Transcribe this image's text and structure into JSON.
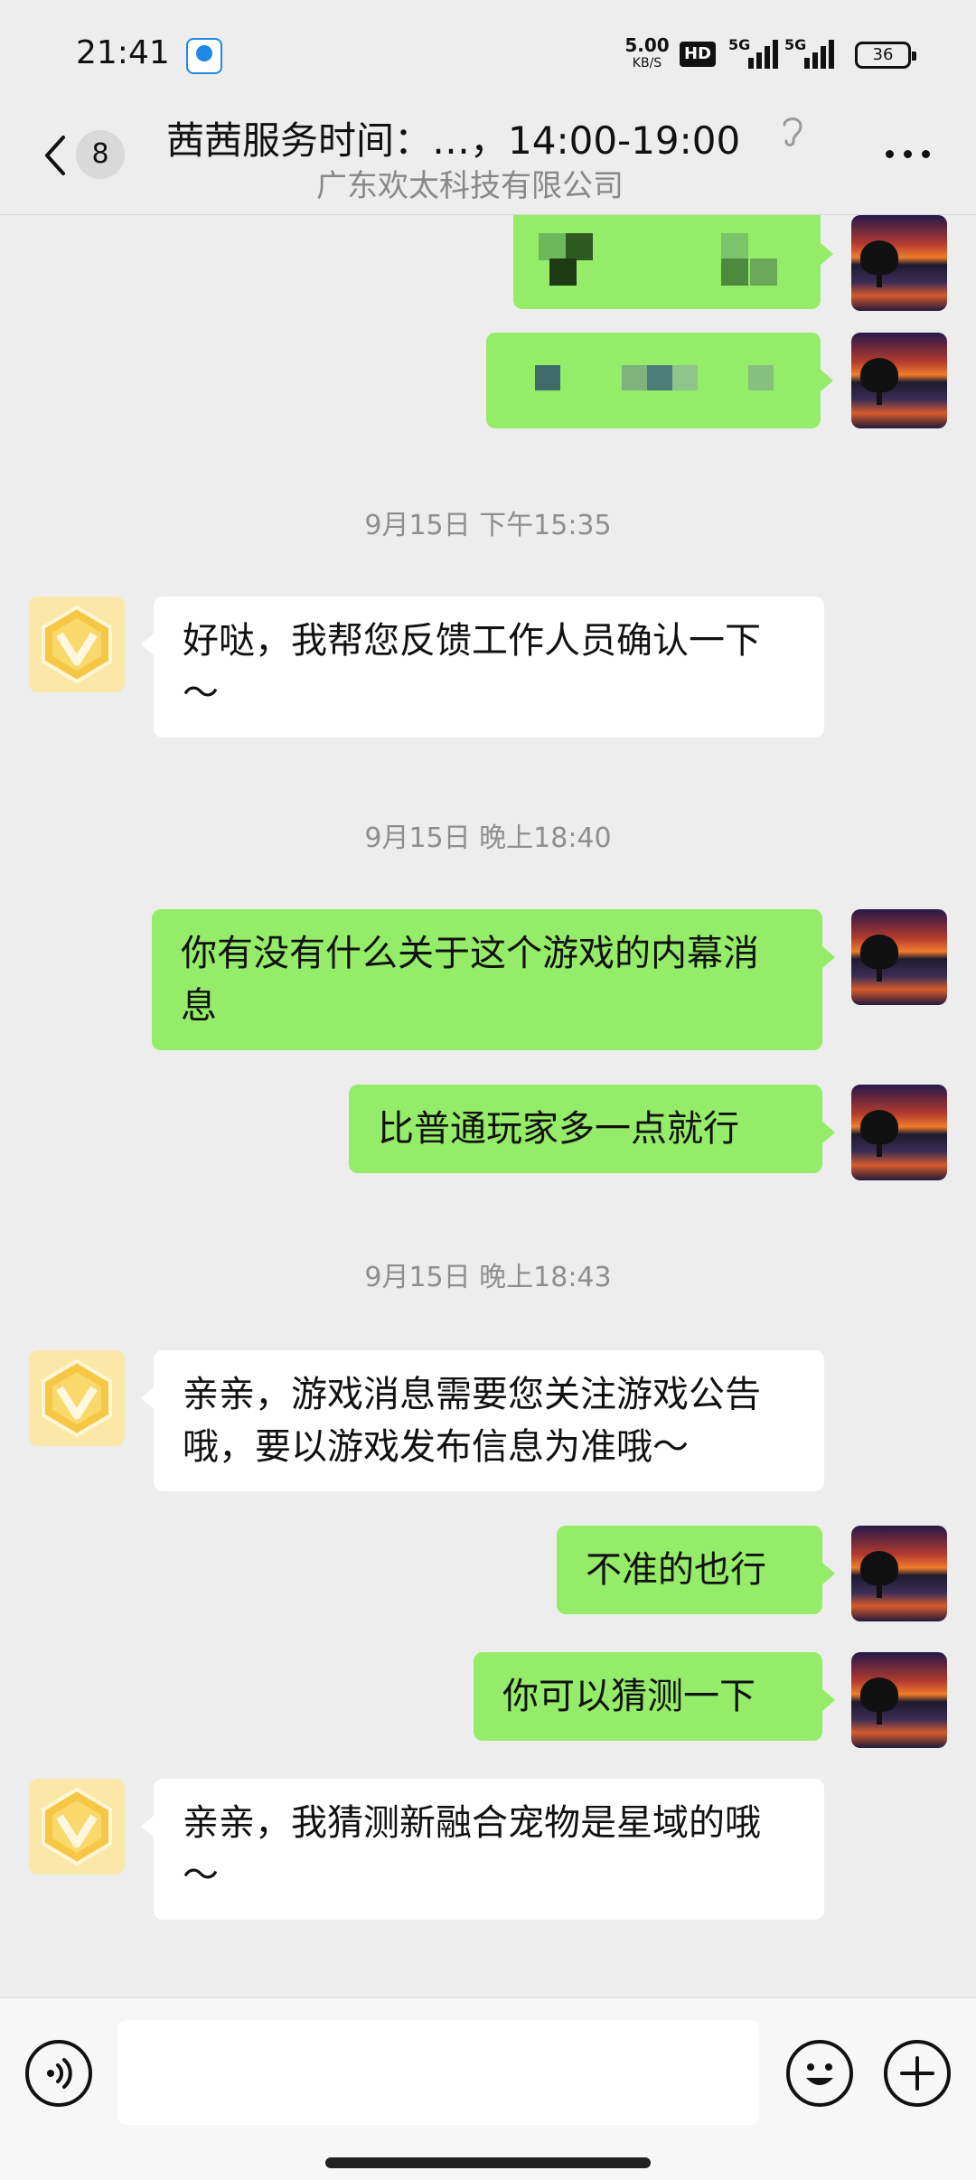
{
  "status_bar": {
    "time": "21:41",
    "net_speed_value": "5.00",
    "net_speed_unit": "KB/S",
    "hd_label": "HD",
    "signal_1_label": "5G",
    "signal_2_label": "5G",
    "battery": "36"
  },
  "header": {
    "unread_count": "8",
    "title": "茜茜服务时间：…，14:00-19:00",
    "subtitle": "广东欢太科技有限公司"
  },
  "messages": [
    {
      "type": "timestamp",
      "text": "9月15日 下午15:35"
    },
    {
      "type": "in",
      "text": "好哒，我帮您反馈工作人员确认一下～"
    },
    {
      "type": "timestamp",
      "text": "9月15日 晚上18:40"
    },
    {
      "type": "out",
      "text": "你有没有什么关于这个游戏的内幕消息"
    },
    {
      "type": "out",
      "text": "比普通玩家多一点就行"
    },
    {
      "type": "timestamp",
      "text": "9月15日 晚上18:43"
    },
    {
      "type": "in",
      "text": "亲亲，游戏消息需要您关注游戏公告哦，要以游戏发布信息为准哦～"
    },
    {
      "type": "out",
      "text": "不准的也行"
    },
    {
      "type": "out",
      "text": "你可以猜测一下"
    },
    {
      "type": "in",
      "text": "亲亲，我猜测新融合宠物是星域的哦～"
    }
  ],
  "input_bar": {
    "input_value": "",
    "icons": [
      "voice-icon",
      "emoji-icon",
      "plus-icon"
    ]
  },
  "colors": {
    "outgoing_bubble": "#95ec69",
    "incoming_bubble": "#ffffff",
    "background": "#ededed",
    "bot_avatar": "#fbe7a8"
  }
}
